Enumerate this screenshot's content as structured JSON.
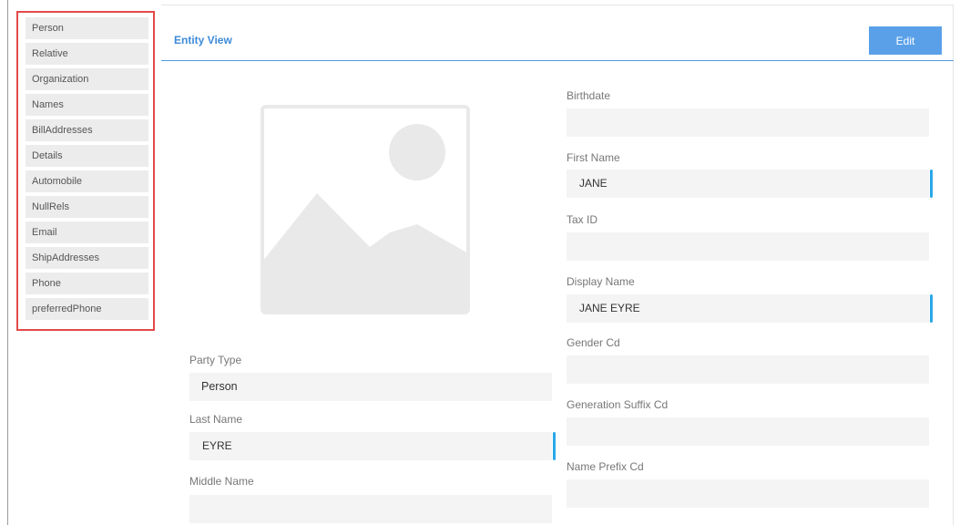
{
  "sidebar": {
    "items": [
      {
        "label": "Person"
      },
      {
        "label": "Relative"
      },
      {
        "label": "Organization"
      },
      {
        "label": "Names"
      },
      {
        "label": "BillAddresses"
      },
      {
        "label": "Details"
      },
      {
        "label": "Automobile"
      },
      {
        "label": "NullRels"
      },
      {
        "label": "Email"
      },
      {
        "label": "ShipAddresses"
      },
      {
        "label": "Phone"
      },
      {
        "label": "preferredPhone"
      }
    ]
  },
  "header": {
    "title": "Entity View",
    "edit_label": "Edit"
  },
  "colors": {
    "accent": "#3d8bd9",
    "button": "#5aa0e8",
    "highlight_border": "#e34a4a",
    "field_marker": "#29a8e8"
  },
  "left_fields": {
    "party_type": {
      "label": "Party Type",
      "value": "Person"
    },
    "last_name": {
      "label": "Last Name",
      "value": "EYRE"
    },
    "middle_name": {
      "label": "Middle Name",
      "value": ""
    }
  },
  "right_fields": {
    "birthdate": {
      "label": "Birthdate",
      "value": ""
    },
    "first_name": {
      "label": "First Name",
      "value": "JANE"
    },
    "tax_id": {
      "label": "Tax ID",
      "value": ""
    },
    "display_name": {
      "label": "Display Name",
      "value": "JANE EYRE"
    },
    "gender_cd": {
      "label": "Gender Cd",
      "value": ""
    },
    "generation_suffix_cd": {
      "label": "Generation Suffix Cd",
      "value": ""
    },
    "name_prefix_cd": {
      "label": "Name Prefix Cd",
      "value": ""
    }
  },
  "image": {
    "icon": "image-placeholder-icon"
  }
}
